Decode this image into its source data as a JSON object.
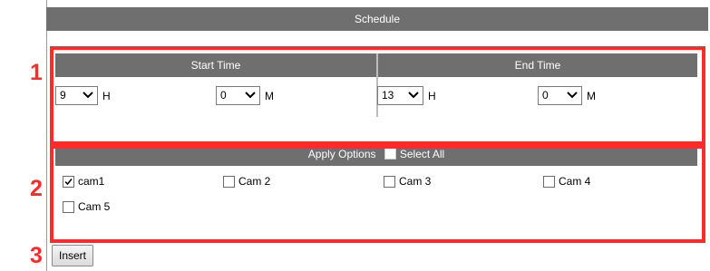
{
  "schedule": {
    "title": "Schedule"
  },
  "time": {
    "start_title": "Start Time",
    "end_title": "End Time",
    "start_hour": "9",
    "start_minute": "0",
    "end_hour": "13",
    "end_minute": "0",
    "hour_unit": "H",
    "minute_unit": "M"
  },
  "apply": {
    "title": "Apply Options",
    "select_all_label": "Select All",
    "cameras": [
      {
        "label": "cam1",
        "checked": true
      },
      {
        "label": "Cam 2",
        "checked": false
      },
      {
        "label": "Cam 3",
        "checked": false
      },
      {
        "label": "Cam 4",
        "checked": false
      },
      {
        "label": "Cam 5",
        "checked": false
      }
    ]
  },
  "actions": {
    "insert_label": "Insert"
  },
  "steps": {
    "one": "1",
    "two": "2",
    "three": "3"
  },
  "colors": {
    "bar": "#6f6f6f",
    "highlight": "#ff2a2a"
  }
}
